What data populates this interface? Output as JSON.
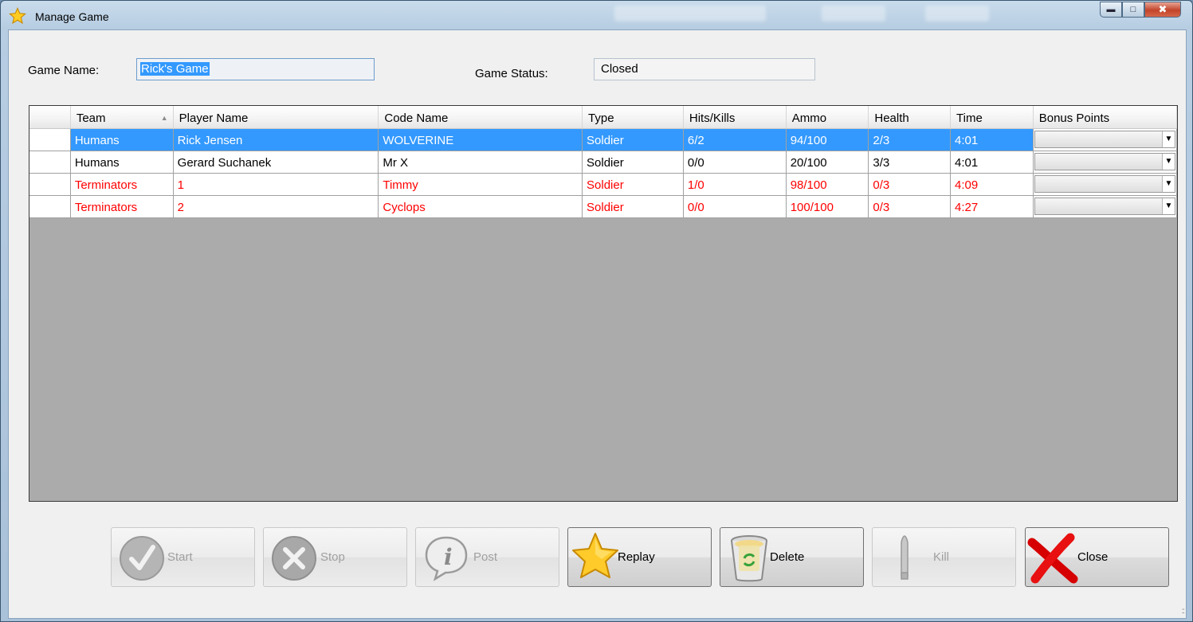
{
  "window": {
    "title": "Manage Game",
    "colors": {
      "selection": "#3399ff",
      "alert_text": "#ff0000",
      "grid_background": "#ababab"
    }
  },
  "form": {
    "game_name_label": "Game Name:",
    "game_name_value": "Rick's Game",
    "game_status_label": "Game Status:",
    "game_status_value": "Closed"
  },
  "grid": {
    "columns": [
      "Team",
      "Player Name",
      "Code Name",
      "Type",
      "Hits/Kills",
      "Ammo",
      "Health",
      "Time",
      "Bonus Points"
    ],
    "sorted_column": "Team",
    "rows": [
      {
        "team": "Humans",
        "player": "Rick Jensen",
        "code": "WOLVERINE",
        "type": "Soldier",
        "hits": "6/2",
        "ammo": "94/100",
        "health": "2/3",
        "time": "4:01",
        "bonus": ""
      },
      {
        "team": "Humans",
        "player": "Gerard Suchanek",
        "code": "Mr X",
        "type": "Soldier",
        "hits": "0/0",
        "ammo": "20/100",
        "health": "3/3",
        "time": "4:01",
        "bonus": ""
      },
      {
        "team": "Terminators",
        "player": "1",
        "code": "Timmy",
        "type": "Soldier",
        "hits": "1/0",
        "ammo": "98/100",
        "health": "0/3",
        "time": "4:09",
        "bonus": ""
      },
      {
        "team": "Terminators",
        "player": "2",
        "code": "Cyclops",
        "type": "Soldier",
        "hits": "0/0",
        "ammo": "100/100",
        "health": "0/3",
        "time": "4:27",
        "bonus": ""
      }
    ]
  },
  "buttons": {
    "start": "Start",
    "stop": "Stop",
    "post": "Post",
    "replay": "Replay",
    "delete": "Delete",
    "kill": "Kill",
    "close": "Close"
  },
  "icons": {
    "app": "star-icon",
    "start": "checkmark-icon",
    "stop": "x-circle-icon",
    "post": "info-bubble-icon",
    "replay": "star-icon",
    "delete": "recycle-bin-icon",
    "kill": "bullet-icon",
    "close": "red-x-icon"
  }
}
